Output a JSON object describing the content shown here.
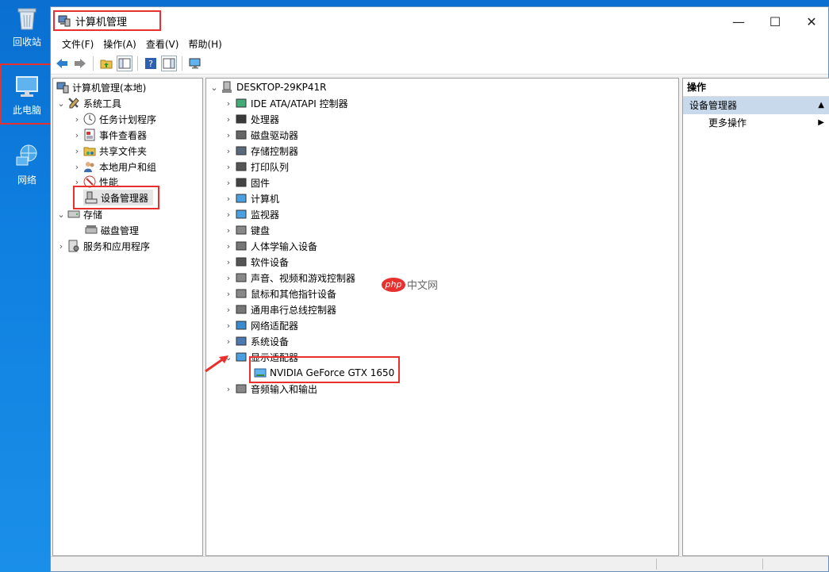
{
  "desktop": {
    "icons": [
      {
        "label": "回收站",
        "icon": "recycle-bin-icon"
      },
      {
        "label": "此电脑",
        "icon": "this-pc-icon"
      },
      {
        "label": "网络",
        "icon": "network-icon"
      }
    ]
  },
  "window": {
    "title": "计算机管理",
    "controls": {
      "minimize": "—",
      "maximize": "☐",
      "close": "✕"
    }
  },
  "menubar": [
    "文件(F)",
    "操作(A)",
    "查看(V)",
    "帮助(H)"
  ],
  "tree": {
    "root": "计算机管理(本地)",
    "items": [
      {
        "label": "系统工具"
      },
      {
        "label": "任务计划程序"
      },
      {
        "label": "事件查看器"
      },
      {
        "label": "共享文件夹"
      },
      {
        "label": "本地用户和组"
      },
      {
        "label": "性能"
      },
      {
        "label": "设备管理器"
      },
      {
        "label": "存储"
      },
      {
        "label": "磁盘管理"
      },
      {
        "label": "服务和应用程序"
      }
    ]
  },
  "devices": {
    "computer": "DESKTOP-29KP41R",
    "categories": [
      "IDE ATA/ATAPI 控制器",
      "处理器",
      "磁盘驱动器",
      "存储控制器",
      "打印队列",
      "固件",
      "计算机",
      "监视器",
      "键盘",
      "人体学输入设备",
      "软件设备",
      "声音、视频和游戏控制器",
      "鼠标和其他指针设备",
      "通用串行总线控制器",
      "网络适配器",
      "系统设备",
      "显示适配器",
      "音频输入和输出"
    ],
    "display_child": "NVIDIA GeForce GTX 1650"
  },
  "actions": {
    "header": "操作",
    "section": "设备管理器",
    "more": "更多操作"
  },
  "watermark": {
    "logo": "php",
    "text": "中文网"
  },
  "colors": {
    "highlight": "#e8312f",
    "desktop": "#0f7fe0",
    "action_section": "#c9d9ec"
  }
}
